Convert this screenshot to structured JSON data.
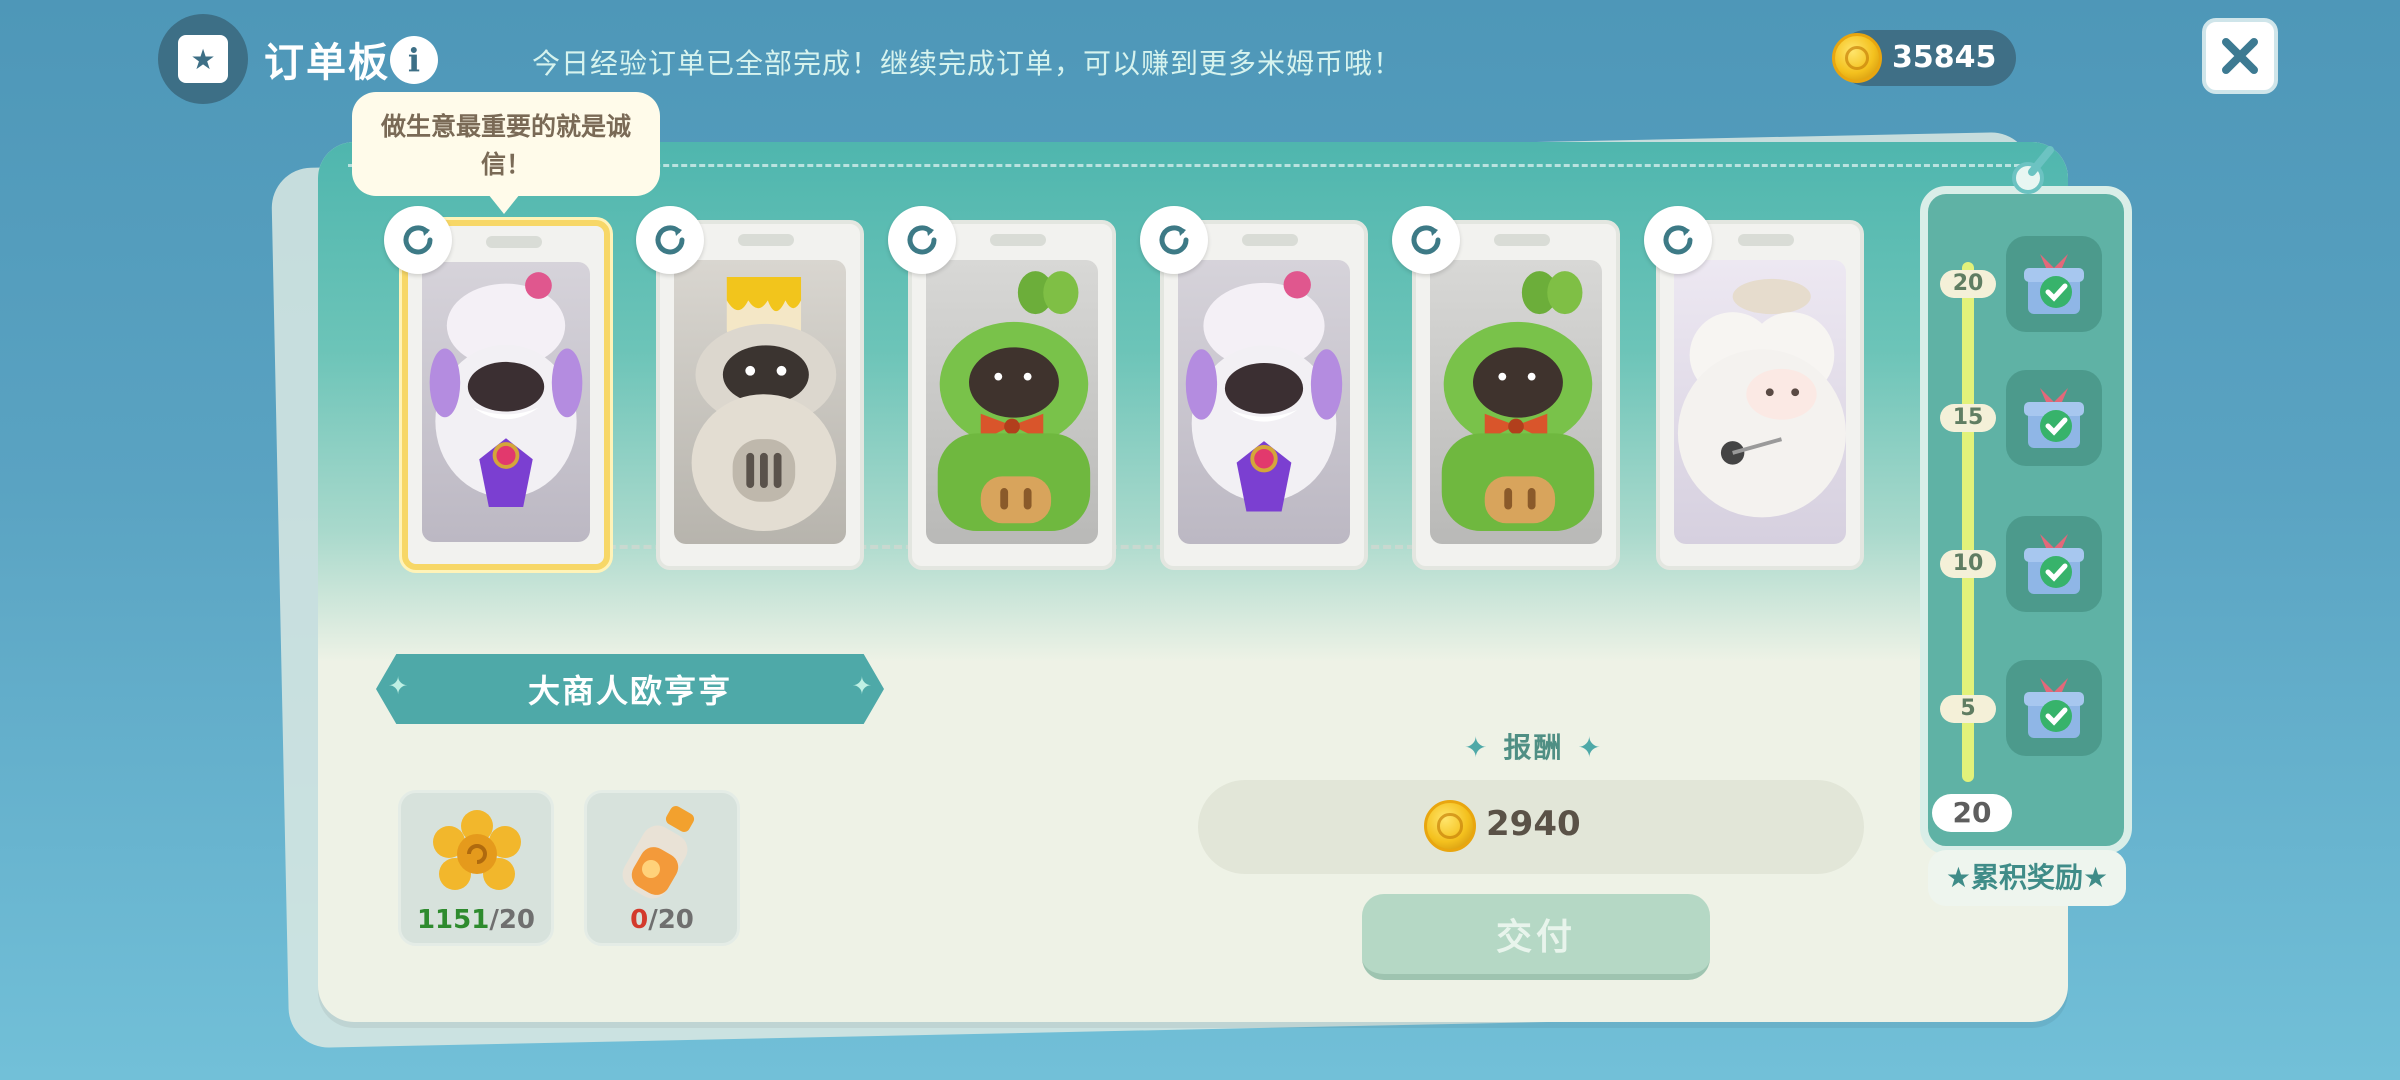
{
  "header": {
    "title": "订单板",
    "info_icon": "info-icon",
    "notice": "今日经验订单已全部完成！继续完成订单，可以赚到更多米姆币哦！",
    "coins": "35845",
    "close_icon": "close-icon"
  },
  "tooltip": "做生意最重要的就是诚信！",
  "cards": [
    {
      "character": "white-chef-hat-character",
      "selected": true
    },
    {
      "character": "paint-bucket-knight-character",
      "selected": false
    },
    {
      "character": "green-leaf-sprout-character",
      "selected": false
    },
    {
      "character": "white-chef-hat-character",
      "selected": false
    },
    {
      "character": "green-leaf-sprout-character",
      "selected": false
    },
    {
      "character": "fluffy-sheep-character",
      "selected": false
    }
  ],
  "merchant": {
    "name": "大商人欧亨亨"
  },
  "materials": [
    {
      "icon": "golden-flower-icon",
      "have": "1151",
      "need": "/20",
      "enough": true
    },
    {
      "icon": "orange-juice-bottle-icon",
      "have": "0",
      "need": "/20",
      "enough": false
    }
  ],
  "reward": {
    "label": "报酬",
    "amount": "2940"
  },
  "deliver_button": "交付",
  "progress": {
    "milestones": [
      {
        "value": "20",
        "claimed": true
      },
      {
        "value": "15",
        "claimed": true
      },
      {
        "value": "10",
        "claimed": true
      },
      {
        "value": "5",
        "claimed": true
      }
    ],
    "current": "20",
    "label": "累积奖励"
  },
  "colors": {
    "accent_teal": "#4ea9a8",
    "coin_gold": "#f4c11e",
    "ok_green": "#2e8b2e",
    "missing_red": "#d33a2c",
    "selected_border": "#f7d767"
  }
}
